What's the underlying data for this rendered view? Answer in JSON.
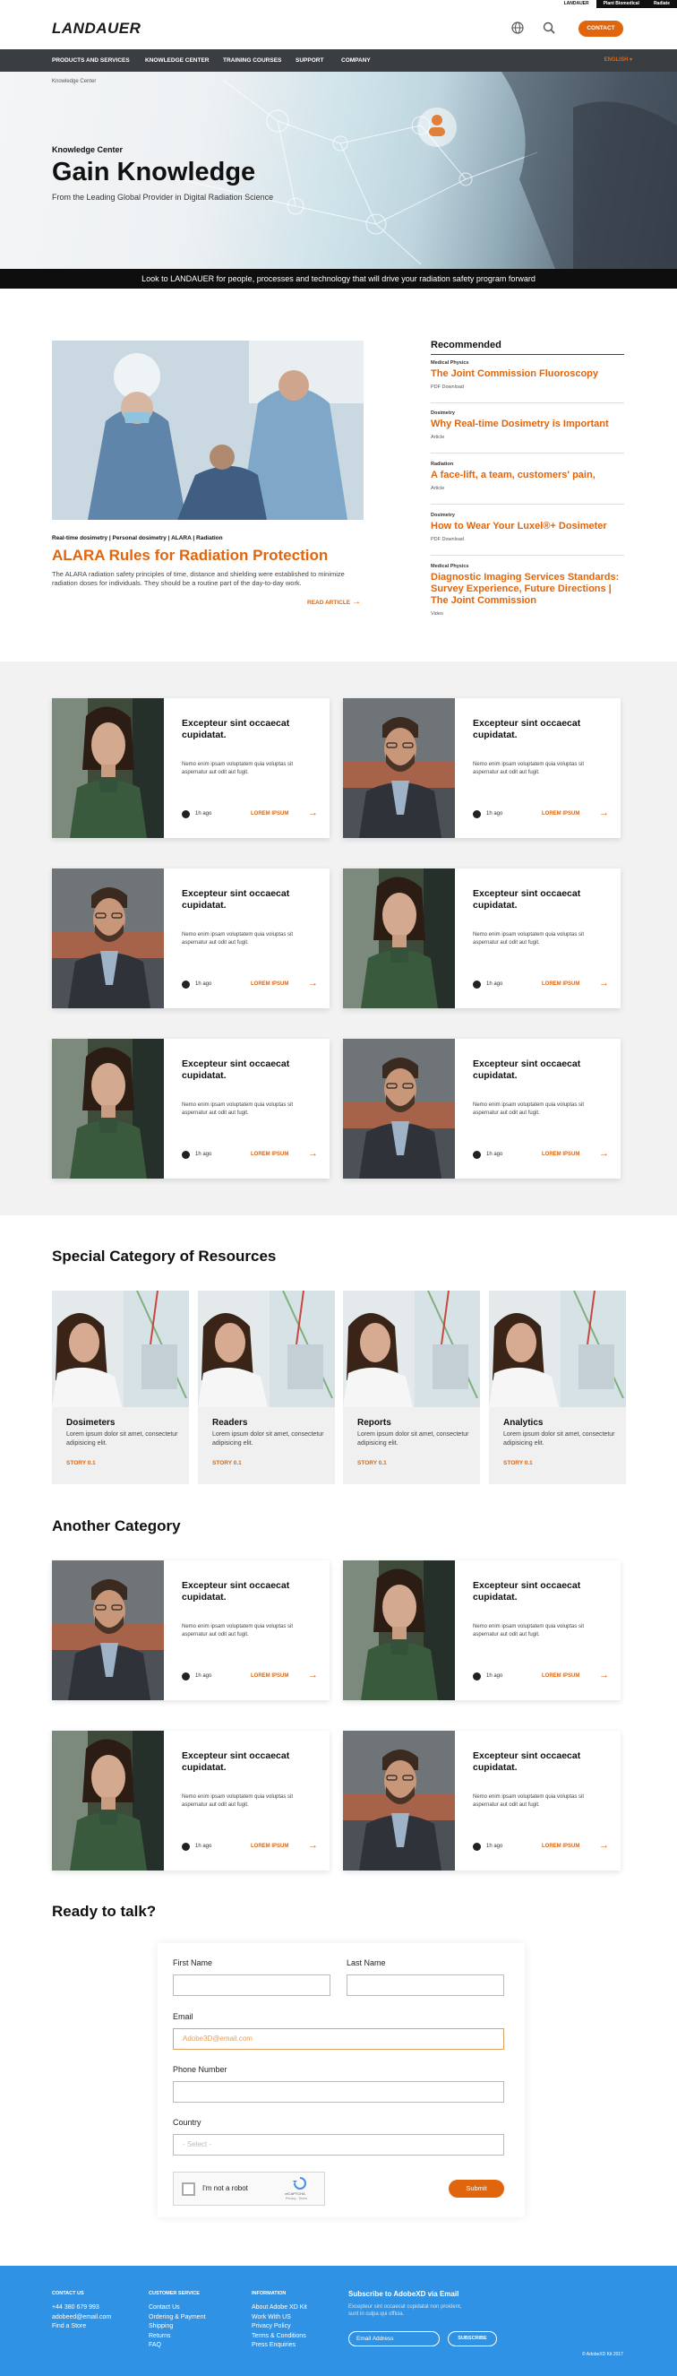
{
  "topbar": {
    "sites": [
      "LANDAUER",
      "Plant Biomedical",
      "Radiate"
    ]
  },
  "header": {
    "logo": "LANDAUER",
    "contact_button": "CONTACT"
  },
  "nav": {
    "items": [
      "PRODUCTS AND SERVICES",
      "KNOWLEDGE CENTER",
      "TRAINING COURSES",
      "SUPPORT",
      "COMPANY"
    ],
    "language": "ENGLISH ▾"
  },
  "hero": {
    "breadcrumb": "Knowledge Center",
    "section": "Knowledge Center",
    "title": "Gain Knowledge",
    "subtitle": "From the Leading Global Provider in Digital Radiation Science"
  },
  "banner": "Look to LANDAUER for people, processes and technology that will drive your radiation safety program forward",
  "featured": {
    "tags": "Real-time dosimetry | Personal dosimetry | ALARA | Radiation",
    "title": "ALARA Rules for Radiation Protection",
    "body": "The ALARA radiation safety principles of time, distance and shielding were established to minimize radiation doses for individuals. They should be a routine part of the day-to-day work.",
    "read_more": "READ ARTICLE"
  },
  "recommended": {
    "heading": "Recommended",
    "items": [
      {
        "category": "Medical Physics",
        "title": "The Joint Commission Fluoroscopy",
        "type": "PDF Download"
      },
      {
        "category": "Dosimetry",
        "title": "Why Real-time Dosimetry is Important",
        "type": "Article"
      },
      {
        "category": "Radiation",
        "title": "A face-lift, a team, customers' pain,",
        "type": "Article"
      },
      {
        "category": "Dosimetry",
        "title": "How to Wear Your Luxel®+ Dosimeter",
        "type": "PDF Download"
      },
      {
        "category": "Medical Physics",
        "title": "Diagnostic Imaging Services Standards: Survey Experience, Future Directions | The Joint Commission",
        "type": "Video"
      }
    ]
  },
  "cards": [
    {
      "title": "Excepteur sint occaecat cupidatat.",
      "body": "Nemo enim ipsam voluptatem quia voluptas sit aspernatur aut odit aut fugit.",
      "time": "1h ago",
      "link": "LOREM IPSUM",
      "person": "woman"
    },
    {
      "title": "Excepteur sint occaecat cupidatat.",
      "body": "Nemo enim ipsam voluptatem quia voluptas sit aspernatur aut odit aut fugit.",
      "time": "1h ago",
      "link": "LOREM IPSUM",
      "person": "man"
    },
    {
      "title": "Excepteur sint occaecat cupidatat.",
      "body": "Nemo enim ipsam voluptatem quia voluptas sit aspernatur aut odit aut fugit.",
      "time": "1h ago",
      "link": "LOREM IPSUM",
      "person": "man"
    },
    {
      "title": "Excepteur sint occaecat cupidatat.",
      "body": "Nemo enim ipsam voluptatem quia voluptas sit aspernatur aut odit aut fugit.",
      "time": "1h ago",
      "link": "LOREM IPSUM",
      "person": "woman"
    },
    {
      "title": "Excepteur sint occaecat cupidatat.",
      "body": "Nemo enim ipsam voluptatem quia voluptas sit aspernatur aut odit aut fugit.",
      "time": "1h ago",
      "link": "LOREM IPSUM",
      "person": "woman"
    },
    {
      "title": "Excepteur sint occaecat cupidatat.",
      "body": "Nemo enim ipsam voluptatem quia voluptas sit aspernatur aut odit aut fugit.",
      "time": "1h ago",
      "link": "LOREM IPSUM",
      "person": "man"
    }
  ],
  "special": {
    "heading": "Special Category of Resources",
    "tiles": [
      {
        "title": "Dosimeters",
        "body": "Lorem ipsum dolor sit amet, consectetur adipisicing elit.",
        "link": "STORY 0.1"
      },
      {
        "title": "Readers",
        "body": "Lorem ipsum dolor sit amet, consectetur adipisicing elit.",
        "link": "STORY 0.1"
      },
      {
        "title": "Reports",
        "body": "Lorem ipsum dolor sit amet, consectetur adipisicing elit.",
        "link": "STORY 0.1"
      },
      {
        "title": "Analytics",
        "body": "Lorem ipsum dolor sit amet, consectetur adipisicing elit.",
        "link": "STORY 0.1"
      }
    ]
  },
  "another": {
    "heading": "Another Category",
    "cards": [
      {
        "title": "Excepteur sint occaecat cupidatat.",
        "body": "Nemo enim ipsam voluptatem quia voluptas sit aspernatur aut odit aut fugit.",
        "time": "1h ago",
        "link": "LOREM IPSUM",
        "person": "man"
      },
      {
        "title": "Excepteur sint occaecat cupidatat.",
        "body": "Nemo enim ipsam voluptatem quia voluptas sit aspernatur aut odit aut fugit.",
        "time": "1h ago",
        "link": "LOREM IPSUM",
        "person": "woman"
      },
      {
        "title": "Excepteur sint occaecat cupidatat.",
        "body": "Nemo enim ipsam voluptatem quia voluptas sit aspernatur aut odit aut fugit.",
        "time": "1h ago",
        "link": "LOREM IPSUM",
        "person": "woman"
      },
      {
        "title": "Excepteur sint occaecat cupidatat.",
        "body": "Nemo enim ipsam voluptatem quia voluptas sit aspernatur aut odit aut fugit.",
        "time": "1h ago",
        "link": "LOREM IPSUM",
        "person": "man"
      }
    ]
  },
  "contact_form": {
    "heading": "Ready to talk?",
    "first_name_label": "First Name",
    "last_name_label": "Last Name",
    "email_label": "Email",
    "email_value": "Adobe3D@email.com",
    "phone_label": "Phone Number",
    "country_label": "Country",
    "country_value": "- Select -",
    "captcha_label": "I'm not a robot",
    "captcha_brand": "reCAPTCHA",
    "captcha_terms": "Privacy - Terms",
    "submit": "Submit"
  },
  "footer": {
    "contact": {
      "heading": "CONTACT US",
      "lines": [
        "+44 380 679 993",
        "adobeed@email.com",
        "Find a Store"
      ]
    },
    "service": {
      "heading": "CUSTOMER SERVICE",
      "lines": [
        "Contact Us",
        "Ordering & Payment",
        "Shipping",
        "Returns",
        "FAQ"
      ]
    },
    "info": {
      "heading": "INFORMATION",
      "lines": [
        "About Adobe XD Kit",
        "Work With US",
        "Privacy Policy",
        "Terms & Conditions",
        "Press Enquiries"
      ]
    },
    "subscribe": {
      "heading": "Subscribe to AdobeXD via Email",
      "body": "Excepteur sint occaecat cupidatat non proident, sunt in culpa qui officia.",
      "placeholder": "Email Address",
      "button": "SUBSCRIBE"
    },
    "copyright": "© AdobeXD Kit 2017"
  },
  "colors": {
    "accent": "#e0650d",
    "footer": "#2f92e4",
    "nav": "#3a3d42"
  }
}
